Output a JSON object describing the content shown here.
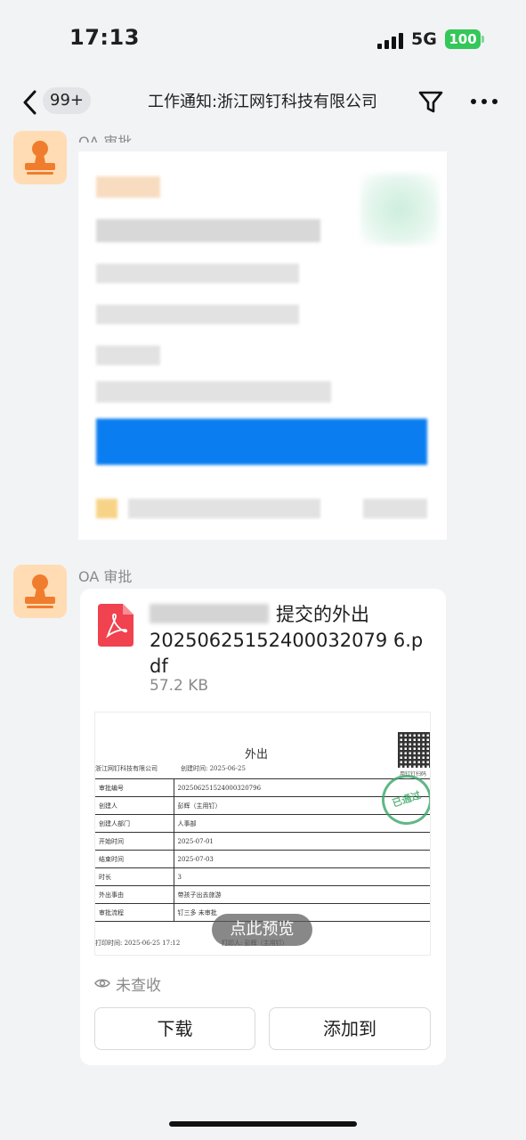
{
  "status_bar": {
    "time": "17:13",
    "network": "5G",
    "battery": "100"
  },
  "nav": {
    "badge": "99+",
    "title": "工作通知:浙江网钉科技有限公司"
  },
  "messages": [
    {
      "sender": "OA 审批"
    },
    {
      "sender": "OA 审批",
      "file": {
        "title_suffix": "提交的外出",
        "file_name": "20250625152400032079 6.pdf",
        "size": "57.2 KB"
      },
      "preview": {
        "doc_title": "外出",
        "company": "浙江网钉科技有限公司",
        "created": "创建时间: 2025-06-25",
        "qr_label": "用钉钉扫码",
        "stamp": "已通过",
        "rows": [
          {
            "k": "审批编号",
            "v": "202506251524000320796"
          },
          {
            "k": "创建人",
            "v": "彭辉（主用钉）"
          },
          {
            "k": "创建人部门",
            "v": "人事部"
          },
          {
            "k": "开始时间",
            "v": "2025-07-01"
          },
          {
            "k": "结束时间",
            "v": "2025-07-03"
          },
          {
            "k": "时长",
            "v": "3"
          },
          {
            "k": "外出事由",
            "v": "带孩子出去旅游"
          },
          {
            "k": "审批流程",
            "v": "钉三多 未审批"
          }
        ],
        "footer_left": "打印时间: 2025-06-25 17:12",
        "footer_right": "打印人: 彭辉（主用钉）",
        "overlay": "点此预览"
      },
      "read_status": "未查收",
      "buttons": {
        "download": "下载",
        "add_to": "添加到"
      }
    }
  ],
  "colors": {
    "accent": "#0a7ef0",
    "stamp": "#3aa667",
    "battery": "#34c759",
    "pdf_icon": "#f0424f"
  }
}
